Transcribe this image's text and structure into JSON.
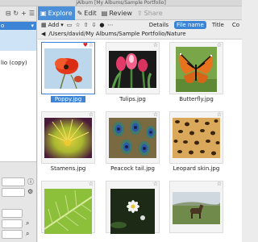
{
  "window": {
    "title": "jAlbum [My Albums/Sample Portfolio]"
  },
  "left_panel": {
    "toolbar_icons": [
      "minus-icon",
      "refresh-icon",
      "add-icon",
      "menu-icon"
    ],
    "tree": [
      {
        "label": "o",
        "selected": true
      },
      {
        "label": "",
        "selected": false
      },
      {
        "label": "lio (copy)",
        "selected": false
      }
    ]
  },
  "tabs": [
    {
      "label": "Explore",
      "icon": "explore-icon",
      "active": true,
      "disabled": false
    },
    {
      "label": "Edit",
      "icon": "edit-icon",
      "active": false,
      "disabled": false
    },
    {
      "label": "Review",
      "icon": "review-icon",
      "active": false,
      "disabled": false
    },
    {
      "label": "Share",
      "icon": "share-icon",
      "active": false,
      "disabled": true
    }
  ],
  "toolbar": {
    "add_label": "Add",
    "sort_labels": [
      "Details",
      "File name",
      "Title",
      "Co"
    ]
  },
  "path": {
    "text": "/Users/david/My Albums/Sample Portfolio/Nature"
  },
  "items": [
    {
      "filename": "Poppy.jpg",
      "selected": true,
      "favorite": true
    },
    {
      "filename": "Tulips.jpg",
      "selected": false,
      "favorite": false
    },
    {
      "filename": "Butterfly.jpg",
      "selected": false,
      "favorite": false
    },
    {
      "filename": "Stamens.jpg",
      "selected": false,
      "favorite": false
    },
    {
      "filename": "Peacock tail.jpg",
      "selected": false,
      "favorite": false
    },
    {
      "filename": "Leopard skin.jpg",
      "selected": false,
      "favorite": false
    },
    {
      "filename": "",
      "selected": false,
      "favorite": false
    },
    {
      "filename": "",
      "selected": false,
      "favorite": false
    },
    {
      "filename": "",
      "selected": false,
      "favorite": false
    }
  ],
  "colors": {
    "accent": "#3b84d6",
    "tab_active": "#4a8fd8"
  }
}
